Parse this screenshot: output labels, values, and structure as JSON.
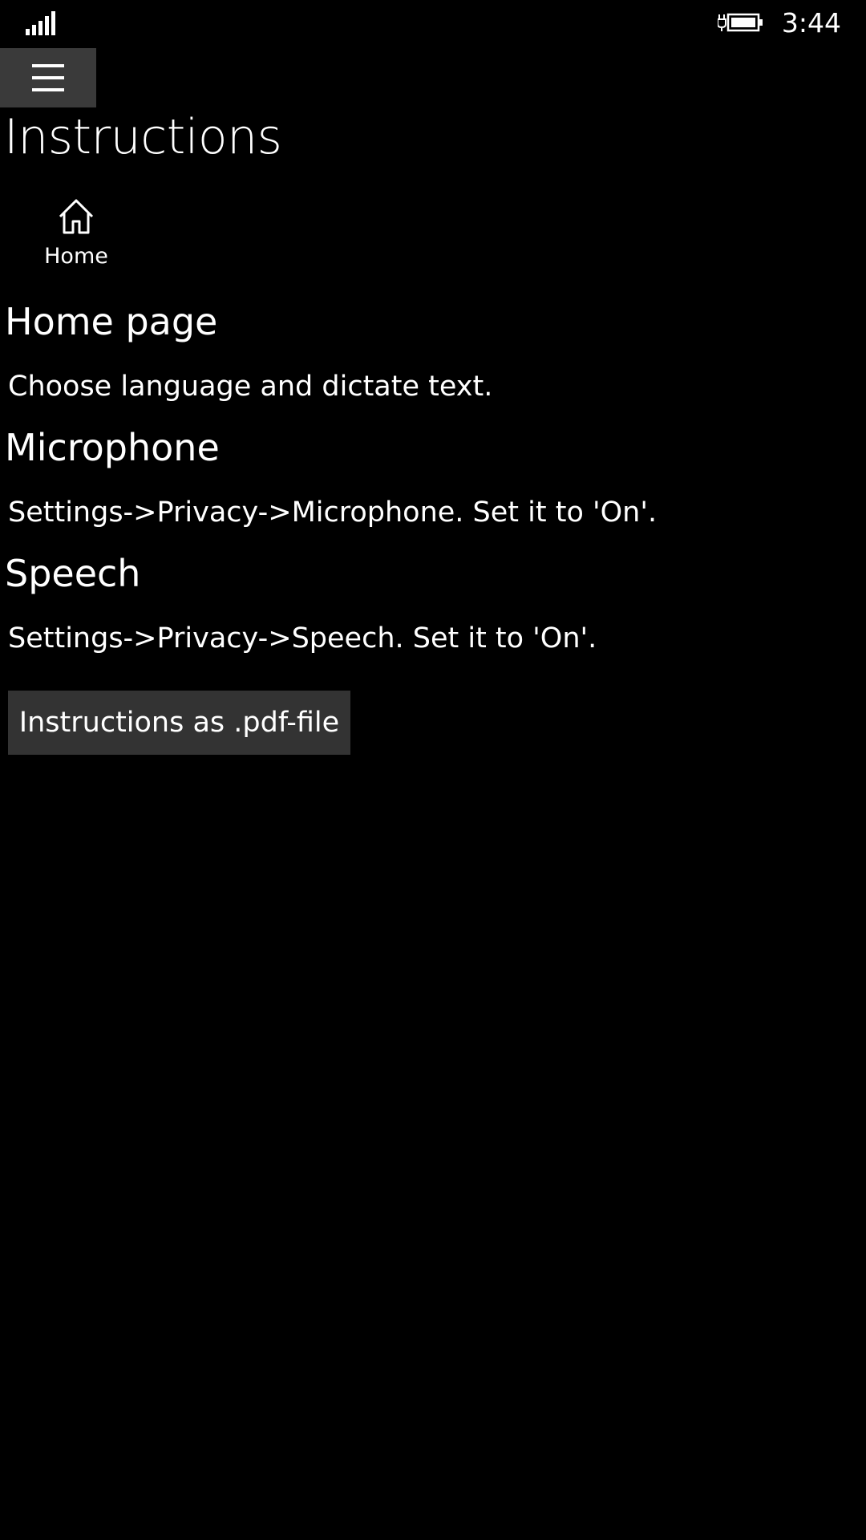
{
  "status_bar": {
    "time": "3:44",
    "signal_icon": "signal-bars-icon",
    "battery_icon": "battery-charging-icon"
  },
  "nav": {
    "menu_icon": "hamburger-icon",
    "home_icon": "home-icon",
    "home_label": "Home"
  },
  "page": {
    "title": "Instructions"
  },
  "sections": [
    {
      "heading": "Home page",
      "text": "Choose language and dictate text."
    },
    {
      "heading": "Microphone",
      "text": "Settings->Privacy->Microphone. Set it to 'On'."
    },
    {
      "heading": "Speech",
      "text": "Settings->Privacy->Speech. Set it to 'On'."
    }
  ],
  "pdf_button": {
    "label": "Instructions as .pdf-file"
  },
  "colors": {
    "background": "#000000",
    "text": "#ffffff",
    "button_bg": "#333333",
    "hamburger_bg": "#3a3a3a"
  }
}
